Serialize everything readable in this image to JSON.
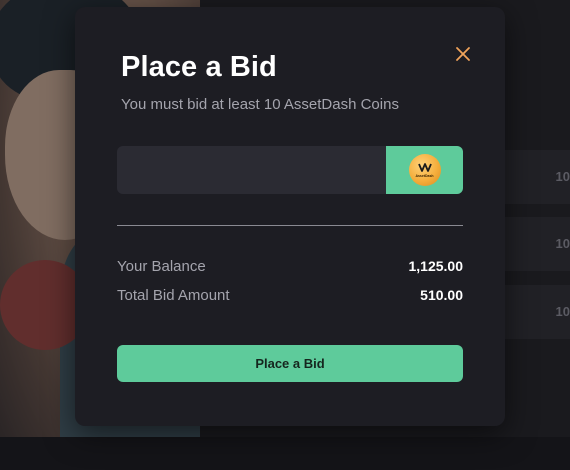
{
  "modal": {
    "title": "Place a Bid",
    "subtitle": "You must bid at least 10 AssetDash Coins",
    "bid_input": {
      "value": "",
      "placeholder": ""
    },
    "coin": {
      "icon": "assetdash-coin-icon",
      "label": "AssetDash"
    },
    "balance_label": "Your Balance",
    "balance_value": "1,125.00",
    "total_label": "Total Bid Amount",
    "total_value": "510.00",
    "cta_label": "Place a Bid",
    "close_icon": "close-icon"
  },
  "background": {
    "row_values": [
      "10",
      "10",
      "10"
    ]
  },
  "colors": {
    "accent": "#5ecb9b",
    "close": "#f0a35b",
    "modal_bg": "#1d1d23",
    "input_bg": "#2b2b33"
  }
}
